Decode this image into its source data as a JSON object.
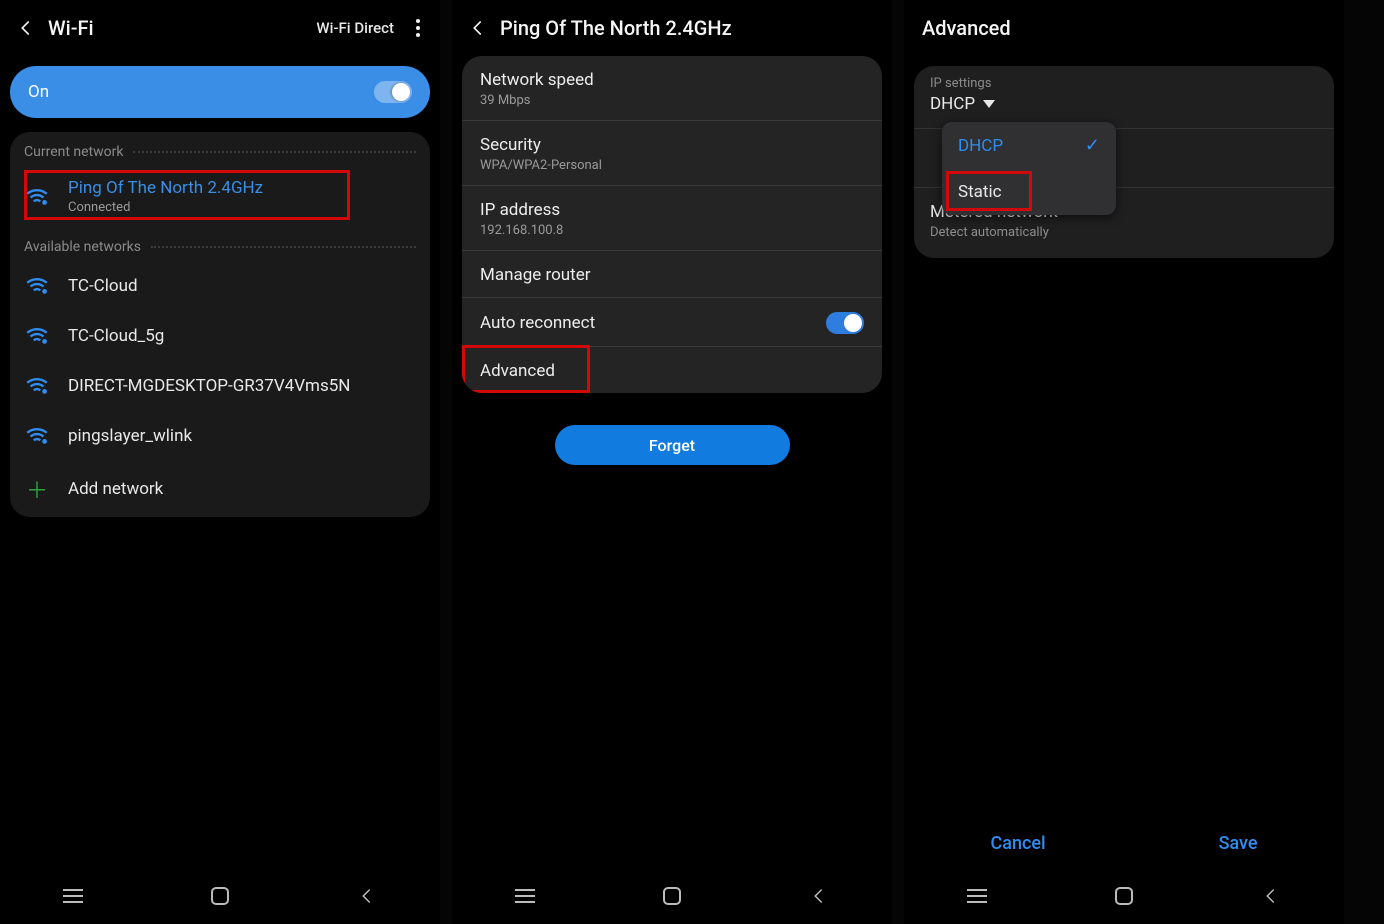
{
  "p1": {
    "title": "Wi-Fi",
    "direct": "Wi-Fi Direct",
    "on": "On",
    "current_label": "Current network",
    "available_label": "Available networks",
    "connected": {
      "ssid": "Ping Of The North 2.4GHz",
      "status": "Connected"
    },
    "nets": [
      {
        "ssid": "TC-Cloud"
      },
      {
        "ssid": "TC-Cloud_5g"
      },
      {
        "ssid": "DIRECT-MGDESKTOP-GR37V4Vms5N"
      },
      {
        "ssid": "pingslayer_wlink"
      }
    ],
    "add": "Add network"
  },
  "p2": {
    "title": "Ping Of The North 2.4GHz",
    "speed_l": "Network speed",
    "speed_v": "39 Mbps",
    "sec_l": "Security",
    "sec_v": "WPA/WPA2-Personal",
    "ip_l": "IP address",
    "ip_v": "192.168.100.8",
    "router": "Manage router",
    "auto": "Auto reconnect",
    "adv": "Advanced",
    "forget": "Forget"
  },
  "p3": {
    "title": "Advanced",
    "ip_l": "IP settings",
    "ip_v": "DHCP",
    "dd": {
      "dhcp": "DHCP",
      "static": "Static"
    },
    "met_l": "Metered network",
    "met_v": "Detect automatically",
    "cancel": "Cancel",
    "save": "Save"
  }
}
